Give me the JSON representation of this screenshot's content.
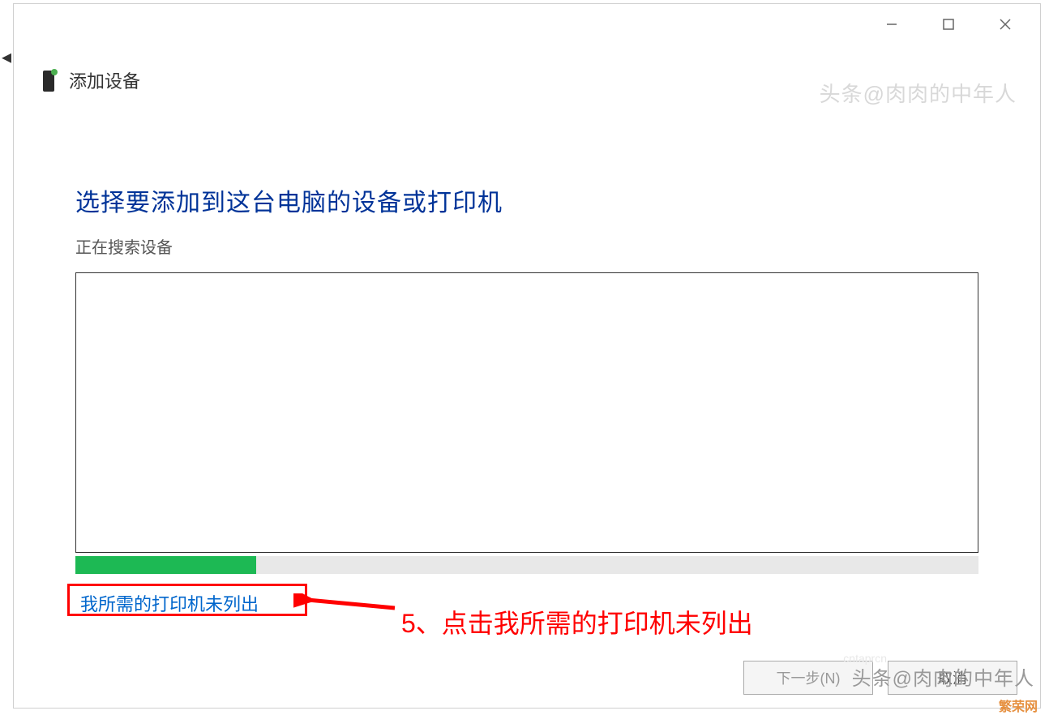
{
  "window": {
    "title": "添加设备"
  },
  "content": {
    "heading": "选择要添加到这台电脑的设备或打印机",
    "subheading": "正在搜索设备",
    "progress_percent": 20,
    "printer_link": "我所需的打印机未列出"
  },
  "buttons": {
    "next": "下一步(N)",
    "cancel": "取消"
  },
  "annotation": {
    "step_text": "5、点击我所需的打印机未列出"
  },
  "watermarks": {
    "header": "头条@肉肉的中年人",
    "bottom": "头条@肉肉的中年人",
    "corner": "繁荣网",
    "faint": "cntaprcn"
  }
}
